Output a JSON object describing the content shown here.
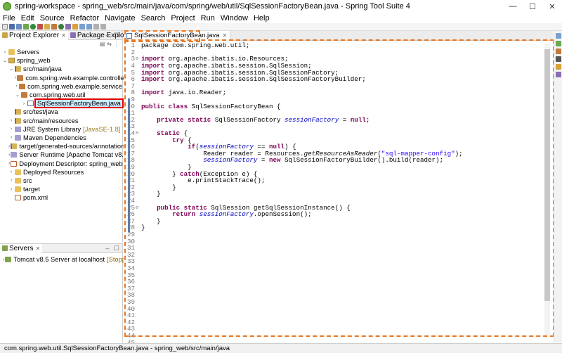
{
  "window": {
    "title": "spring-workspace - spring_web/src/main/java/com/spring/web/util/SqlSessionFactoryBean.java - Spring Tool Suite 4",
    "controls": [
      "—",
      "☐",
      "✕"
    ]
  },
  "menu": [
    "File",
    "Edit",
    "Source",
    "Refactor",
    "Navigate",
    "Search",
    "Project",
    "Run",
    "Window",
    "Help"
  ],
  "left_tabs": [
    {
      "label": "Project Explorer",
      "icon": "project-explorer-icon",
      "active": true
    },
    {
      "label": "Package Explorer",
      "icon": "package-explorer-icon",
      "active": false
    }
  ],
  "tree": [
    {
      "indent": 0,
      "twisty": "›",
      "icon": "folder",
      "label": "Servers"
    },
    {
      "indent": 0,
      "twisty": "⌄",
      "icon": "project",
      "label": "spring_web"
    },
    {
      "indent": 1,
      "twisty": "⌄",
      "icon": "srcfolder",
      "label": "src/main/java"
    },
    {
      "indent": 2,
      "twisty": "›",
      "icon": "package",
      "label": "com.spring.web.example.controller"
    },
    {
      "indent": 2,
      "twisty": "›",
      "icon": "package",
      "label": "com.spring.web.example.service"
    },
    {
      "indent": 2,
      "twisty": "⌄",
      "icon": "package",
      "label": "com.spring.web.util"
    },
    {
      "indent": 3,
      "twisty": "›",
      "icon": "java",
      "label": "SqlSessionFactoryBean.java",
      "highlight": true
    },
    {
      "indent": 1,
      "twisty": "",
      "icon": "srcfolder",
      "label": "src/test/java"
    },
    {
      "indent": 1,
      "twisty": "›",
      "icon": "srcfolder",
      "label": "src/main/resources"
    },
    {
      "indent": 1,
      "twisty": "›",
      "icon": "lib",
      "label": "JRE System Library",
      "decor": "[JavaSE-1.8]"
    },
    {
      "indent": 1,
      "twisty": "›",
      "icon": "lib",
      "label": "Maven Dependencies"
    },
    {
      "indent": 1,
      "twisty": "›",
      "icon": "srcfolder",
      "label": "target/generated-sources/annotations"
    },
    {
      "indent": 1,
      "twisty": "›",
      "icon": "lib",
      "label": "Server Runtime [Apache Tomcat v8.5]"
    },
    {
      "indent": 1,
      "twisty": "›",
      "icon": "xml",
      "label": "Deployment Descriptor: spring_web"
    },
    {
      "indent": 1,
      "twisty": "›",
      "icon": "folder",
      "label": "Deployed Resources"
    },
    {
      "indent": 1,
      "twisty": "›",
      "icon": "folder",
      "label": "src"
    },
    {
      "indent": 1,
      "twisty": "›",
      "icon": "folder",
      "label": "target"
    },
    {
      "indent": 1,
      "twisty": "",
      "icon": "xml",
      "label": "pom.xml"
    }
  ],
  "servers": {
    "tab_label": "Servers",
    "items": [
      {
        "label": "Tomcat v8.5 Server at localhost",
        "status": "[Stopped]"
      }
    ]
  },
  "editor": {
    "tab_label": "SqlSessionFactoryBean.java",
    "lines": [
      {
        "n": "1",
        "fold": "",
        "segs": [
          {
            "t": "package com.spring.web.util;",
            "c": ""
          }
        ]
      },
      {
        "n": "2",
        "fold": "",
        "segs": []
      },
      {
        "n": "3",
        "fold": "⊖",
        "segs": [
          {
            "t": "import",
            "c": "kw"
          },
          {
            "t": " org.apache.ibatis.io.Resources;",
            "c": ""
          }
        ]
      },
      {
        "n": "4",
        "fold": "",
        "segs": [
          {
            "t": "import",
            "c": "kw"
          },
          {
            "t": " org.apache.ibatis.session.SqlSession;",
            "c": ""
          }
        ]
      },
      {
        "n": "5",
        "fold": "",
        "segs": [
          {
            "t": "import",
            "c": "kw"
          },
          {
            "t": " org.apache.ibatis.session.SqlSessionFactory;",
            "c": ""
          }
        ]
      },
      {
        "n": "6",
        "fold": "",
        "segs": [
          {
            "t": "import",
            "c": "kw"
          },
          {
            "t": " org.apache.ibatis.session.SqlSessionFactoryBuilder;",
            "c": ""
          }
        ]
      },
      {
        "n": "7",
        "fold": "",
        "segs": []
      },
      {
        "n": "8",
        "fold": "",
        "segs": [
          {
            "t": "import",
            "c": "kw"
          },
          {
            "t": " java.io.Reader;",
            "c": ""
          }
        ]
      },
      {
        "n": "9",
        "fold": "",
        "segs": []
      },
      {
        "n": "10",
        "fold": "",
        "segs": [
          {
            "t": "public class",
            "c": "kw"
          },
          {
            "t": " SqlSessionFactoryBean {",
            "c": ""
          }
        ]
      },
      {
        "n": "11",
        "fold": "",
        "segs": []
      },
      {
        "n": "12",
        "fold": "",
        "segs": [
          {
            "t": "    ",
            "c": ""
          },
          {
            "t": "private static",
            "c": "kw"
          },
          {
            "t": " SqlSessionFactory ",
            "c": ""
          },
          {
            "t": "sessionFactory",
            "c": "fld"
          },
          {
            "t": " = ",
            "c": ""
          },
          {
            "t": "null",
            "c": "kw"
          },
          {
            "t": ";",
            "c": ""
          }
        ]
      },
      {
        "n": "13",
        "fold": "",
        "segs": []
      },
      {
        "n": "14",
        "fold": "⊖",
        "segs": [
          {
            "t": "    ",
            "c": ""
          },
          {
            "t": "static",
            "c": "kw"
          },
          {
            "t": " {",
            "c": ""
          }
        ]
      },
      {
        "n": "15",
        "fold": "",
        "segs": [
          {
            "t": "        ",
            "c": ""
          },
          {
            "t": "try",
            "c": "kw"
          },
          {
            "t": " {",
            "c": ""
          }
        ]
      },
      {
        "n": "16",
        "fold": "",
        "segs": [
          {
            "t": "            ",
            "c": ""
          },
          {
            "t": "if",
            "c": "kw"
          },
          {
            "t": "(",
            "c": ""
          },
          {
            "t": "sessionFactory",
            "c": "fld"
          },
          {
            "t": " == ",
            "c": ""
          },
          {
            "t": "null",
            "c": "kw"
          },
          {
            "t": ") {",
            "c": ""
          }
        ]
      },
      {
        "n": "17",
        "fold": "",
        "segs": [
          {
            "t": "                Reader reader = Resources.",
            "c": ""
          },
          {
            "t": "getResourceAsReader",
            "c": "mth-i"
          },
          {
            "t": "(",
            "c": ""
          },
          {
            "t": "\"sql-mapper-config\"",
            "c": "str"
          },
          {
            "t": ");",
            "c": ""
          }
        ]
      },
      {
        "n": "18",
        "fold": "",
        "segs": [
          {
            "t": "                ",
            "c": ""
          },
          {
            "t": "sessionFactory",
            "c": "fld"
          },
          {
            "t": " = ",
            "c": ""
          },
          {
            "t": "new",
            "c": "kw"
          },
          {
            "t": " SqlSessionFactoryBuilder().build(reader);",
            "c": ""
          }
        ]
      },
      {
        "n": "19",
        "fold": "",
        "segs": [
          {
            "t": "            }",
            "c": ""
          }
        ]
      },
      {
        "n": "20",
        "fold": "",
        "segs": [
          {
            "t": "        } ",
            "c": ""
          },
          {
            "t": "catch",
            "c": "kw"
          },
          {
            "t": "(Exception e) {",
            "c": ""
          }
        ]
      },
      {
        "n": "21",
        "fold": "",
        "segs": [
          {
            "t": "            e.printStackTrace();",
            "c": ""
          }
        ]
      },
      {
        "n": "22",
        "fold": "",
        "segs": [
          {
            "t": "        }",
            "c": ""
          }
        ]
      },
      {
        "n": "23",
        "fold": "",
        "segs": [
          {
            "t": "    }",
            "c": ""
          }
        ]
      },
      {
        "n": "24",
        "fold": "",
        "segs": []
      },
      {
        "n": "25",
        "fold": "⊖",
        "segs": [
          {
            "t": "    ",
            "c": ""
          },
          {
            "t": "public static",
            "c": "kw"
          },
          {
            "t": " SqlSession getSqlSessionInstance() {",
            "c": ""
          }
        ]
      },
      {
        "n": "26",
        "fold": "",
        "segs": [
          {
            "t": "        ",
            "c": ""
          },
          {
            "t": "return",
            "c": "kw"
          },
          {
            "t": " ",
            "c": ""
          },
          {
            "t": "sessionFactory",
            "c": "fld"
          },
          {
            "t": ".openSession();",
            "c": ""
          }
        ]
      },
      {
        "n": "27",
        "fold": "",
        "segs": [
          {
            "t": "    }",
            "c": ""
          }
        ]
      },
      {
        "n": "28",
        "fold": "",
        "segs": [
          {
            "t": "}",
            "c": ""
          }
        ]
      },
      {
        "n": "29",
        "fold": "",
        "segs": []
      },
      {
        "n": "30",
        "fold": "",
        "segs": []
      },
      {
        "n": "31",
        "fold": "",
        "segs": []
      },
      {
        "n": "32",
        "fold": "",
        "segs": []
      },
      {
        "n": "33",
        "fold": "",
        "segs": []
      },
      {
        "n": "34",
        "fold": "",
        "segs": []
      },
      {
        "n": "35",
        "fold": "",
        "segs": []
      },
      {
        "n": "36",
        "fold": "",
        "segs": []
      },
      {
        "n": "37",
        "fold": "",
        "segs": []
      },
      {
        "n": "38",
        "fold": "",
        "segs": []
      },
      {
        "n": "39",
        "fold": "",
        "segs": []
      },
      {
        "n": "40",
        "fold": "",
        "segs": []
      },
      {
        "n": "41",
        "fold": "",
        "segs": []
      },
      {
        "n": "42",
        "fold": "",
        "segs": []
      },
      {
        "n": "43",
        "fold": "",
        "segs": []
      },
      {
        "n": "44",
        "fold": "",
        "segs": []
      },
      {
        "n": "45",
        "fold": "",
        "segs": []
      }
    ]
  },
  "status": {
    "text": "com.spring.web.util.SqlSessionFactoryBean.java - spring_web/src/main/java"
  },
  "colors": {
    "highlight_box": "#e00000",
    "dashed_annotation": "#e87722",
    "keyword": "#7f0055",
    "field": "#0000c0",
    "string": "#2a00ff"
  }
}
